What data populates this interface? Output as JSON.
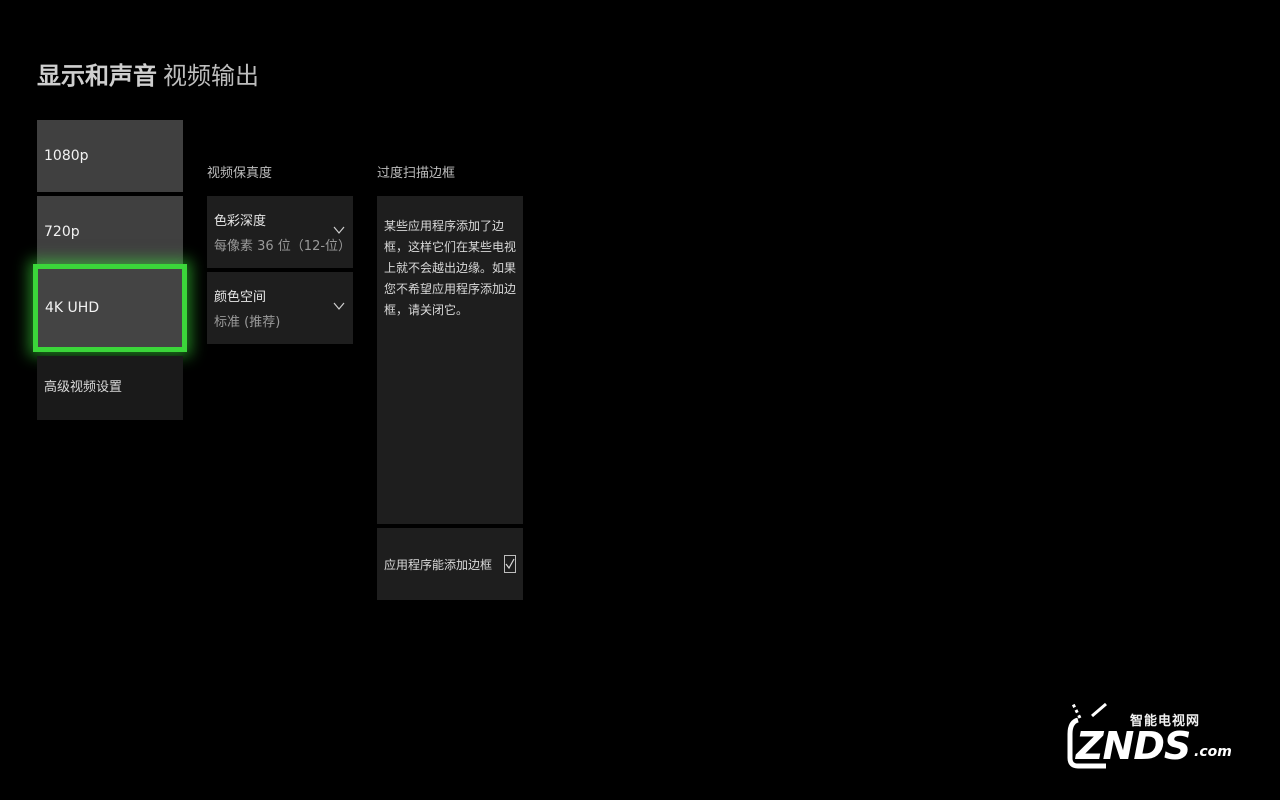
{
  "header": {
    "title": "显示和声音",
    "subtitle": "视频输出"
  },
  "resolution_list": {
    "items": [
      {
        "label": "1080p",
        "selected": false
      },
      {
        "label": "720p",
        "selected": false
      },
      {
        "label": "4K UHD",
        "selected": true
      },
      {
        "label": "高级视频设置",
        "selected": false
      }
    ]
  },
  "video_fidelity": {
    "heading": "视频保真度",
    "color_depth": {
      "label": "色彩深度",
      "value": "每像素 36 位（12-位）"
    },
    "color_space": {
      "label": "颜色空间",
      "value": "标准 (推荐)"
    }
  },
  "overscan": {
    "heading": "过度扫描边框",
    "description": "某些应用程序添加了边框，这样它们在某些电视上就不会越出边缘。如果您不希望应用程序添加边框，请关闭它。",
    "checkbox_label": "应用程序能添加边框",
    "checkbox_checked": true
  },
  "watermark": {
    "cn_text": "智能电视网",
    "en_text": "ZNDS",
    "domain_suffix": ".com"
  },
  "colors": {
    "background": "#000000",
    "focus_accent": "#3bd63a",
    "tile": "#404040",
    "panel": "#1e1e1e"
  },
  "icons": {
    "dropdown": "chevron-down-icon",
    "checkbox": "checkmark-icon",
    "logo": "tv-antenna-logo"
  }
}
